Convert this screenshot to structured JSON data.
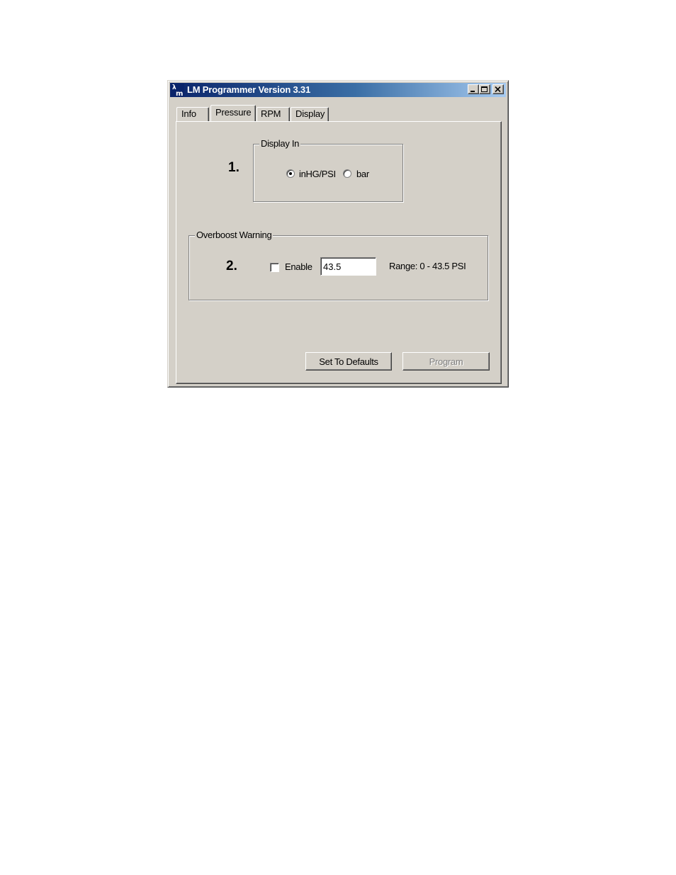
{
  "window": {
    "title": "LM Programmer Version 3.31",
    "minimize_glyph": "_",
    "maximize_glyph": "□",
    "close_glyph": "×"
  },
  "tabs": [
    {
      "label": "Info",
      "active": false
    },
    {
      "label": "Pressure",
      "active": true
    },
    {
      "label": "RPM",
      "active": false
    },
    {
      "label": "Display",
      "active": false
    }
  ],
  "display_in": {
    "group_label": "Display In",
    "step": "1.",
    "options": [
      {
        "label": "inHG/PSI",
        "selected": true
      },
      {
        "label": "bar",
        "selected": false
      }
    ]
  },
  "overboost": {
    "group_label": "Overboost Warning",
    "step": "2.",
    "enable_label": "Enable",
    "enabled": false,
    "value": "43.5",
    "range_label": "Range: 0 - 43.5 PSI"
  },
  "buttons": {
    "defaults_label": "Set To Defaults",
    "program_label": "Program",
    "program_disabled": true
  }
}
